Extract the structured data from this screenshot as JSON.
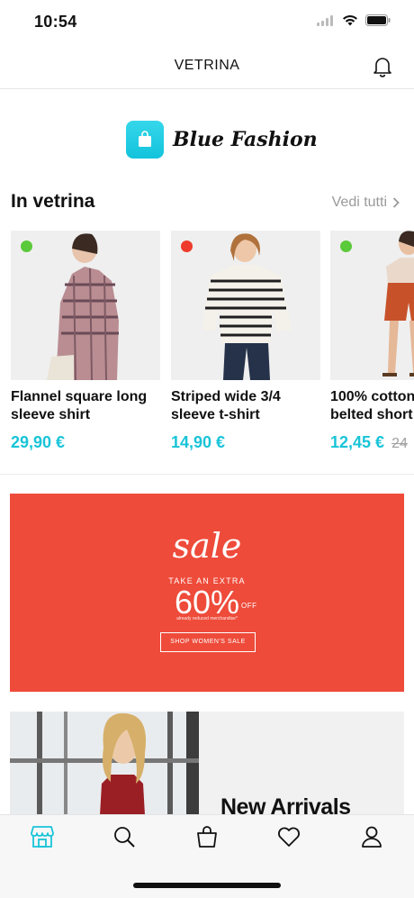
{
  "status_bar": {
    "time": "10:54"
  },
  "nav": {
    "title": "VETRINA"
  },
  "brand": {
    "name": "Blue Fashion"
  },
  "section": {
    "title": "In vetrina",
    "see_all": "Vedi tutti"
  },
  "products": [
    {
      "title": "Flannel square long\nsleeve shirt",
      "price": "29,90 €",
      "old_price": "",
      "dot_color": "#5ac93a"
    },
    {
      "title": "Striped wide 3/4\nsleeve t-shirt",
      "price": "14,90 €",
      "old_price": "",
      "dot_color": "#ee3b2b"
    },
    {
      "title": "100% cotton\nbelted short",
      "price": "12,45 €",
      "old_price": "24",
      "dot_color": "#5ac93a"
    }
  ],
  "banner": {
    "sale": "sale",
    "take": "TAKE AN EXTRA",
    "percent": "60%",
    "off": "OFF",
    "note": "already reduced merchandise*",
    "button": "SHOP WOMEN'S SALE"
  },
  "promo": {
    "title": "New Arrivals"
  },
  "colors": {
    "accent": "#19c4d8",
    "banner": "#ee4b3a"
  },
  "tabs": [
    {
      "icon": "store-icon",
      "active": true
    },
    {
      "icon": "search-icon",
      "active": false
    },
    {
      "icon": "bag-icon",
      "active": false
    },
    {
      "icon": "heart-icon",
      "active": false
    },
    {
      "icon": "profile-icon",
      "active": false
    }
  ]
}
